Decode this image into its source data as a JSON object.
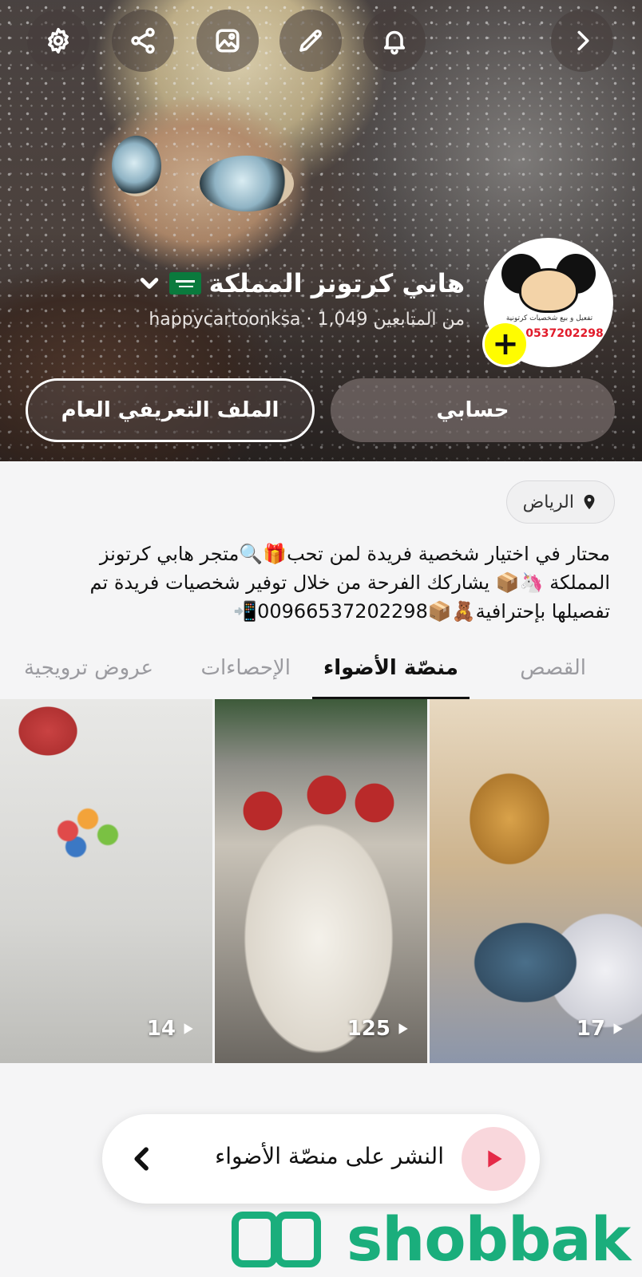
{
  "header": {
    "title": "هابي كرتونز المملكة",
    "subtitle": "happycartoonksa · 1,049 من المتابعين",
    "account_button": "حسابي",
    "public_profile_button": "الملف التعريفي العام",
    "avatar_phone": "0537202298",
    "avatar_tag": "تفعيل و بيع شخصيات كرتونية",
    "top_icons": [
      "chevron-right-icon",
      "bell-icon",
      "pencil-icon",
      "image-icon",
      "share-icon",
      "gear-icon"
    ]
  },
  "location": "الرياض",
  "bio": "محتار في اختيار شخصية فريدة لمن تحب🎁🔍متجر هابي كرتونز المملكة 🦄📦 يشاركك الفرحة من خلال توفير شخصيات فريدة تم تفصيلها بإحترافية🧸📦00966537202298📲",
  "tabs": [
    {
      "label": "القصص",
      "active": false
    },
    {
      "label": "منصّة الأضواء",
      "active": true
    },
    {
      "label": "الإحصاءات",
      "active": false
    },
    {
      "label": "عروض ترويجية",
      "active": false
    }
  ],
  "tiles": [
    {
      "count": "17"
    },
    {
      "count": "125"
    },
    {
      "count": "14"
    }
  ],
  "post_bar": {
    "label": "النشر على منصّة الأضواء"
  },
  "watermark": "shobbak",
  "colors": {
    "accent_yellow": "#fffc00",
    "spotlight_red": "#e52a48",
    "watermark_green": "#1aae7c"
  }
}
